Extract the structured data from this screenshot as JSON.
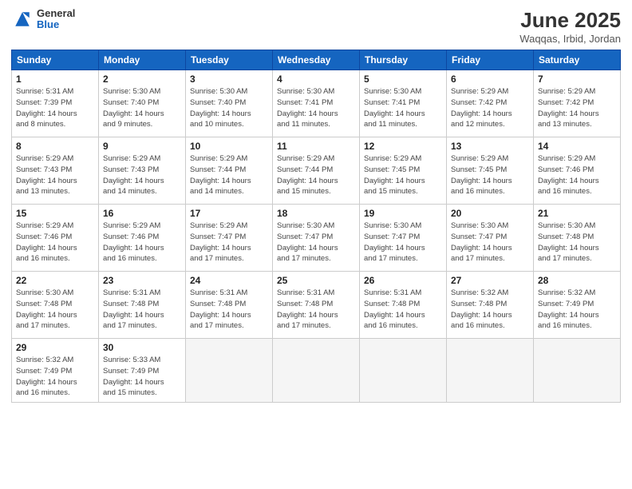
{
  "header": {
    "logo_general": "General",
    "logo_blue": "Blue",
    "month_title": "June 2025",
    "location": "Waqqas, Irbid, Jordan"
  },
  "weekdays": [
    "Sunday",
    "Monday",
    "Tuesday",
    "Wednesday",
    "Thursday",
    "Friday",
    "Saturday"
  ],
  "weeks": [
    [
      {
        "day": "1",
        "info": "Sunrise: 5:31 AM\nSunset: 7:39 PM\nDaylight: 14 hours\nand 8 minutes."
      },
      {
        "day": "2",
        "info": "Sunrise: 5:30 AM\nSunset: 7:40 PM\nDaylight: 14 hours\nand 9 minutes."
      },
      {
        "day": "3",
        "info": "Sunrise: 5:30 AM\nSunset: 7:40 PM\nDaylight: 14 hours\nand 10 minutes."
      },
      {
        "day": "4",
        "info": "Sunrise: 5:30 AM\nSunset: 7:41 PM\nDaylight: 14 hours\nand 11 minutes."
      },
      {
        "day": "5",
        "info": "Sunrise: 5:30 AM\nSunset: 7:41 PM\nDaylight: 14 hours\nand 11 minutes."
      },
      {
        "day": "6",
        "info": "Sunrise: 5:29 AM\nSunset: 7:42 PM\nDaylight: 14 hours\nand 12 minutes."
      },
      {
        "day": "7",
        "info": "Sunrise: 5:29 AM\nSunset: 7:42 PM\nDaylight: 14 hours\nand 13 minutes."
      }
    ],
    [
      {
        "day": "8",
        "info": "Sunrise: 5:29 AM\nSunset: 7:43 PM\nDaylight: 14 hours\nand 13 minutes."
      },
      {
        "day": "9",
        "info": "Sunrise: 5:29 AM\nSunset: 7:43 PM\nDaylight: 14 hours\nand 14 minutes."
      },
      {
        "day": "10",
        "info": "Sunrise: 5:29 AM\nSunset: 7:44 PM\nDaylight: 14 hours\nand 14 minutes."
      },
      {
        "day": "11",
        "info": "Sunrise: 5:29 AM\nSunset: 7:44 PM\nDaylight: 14 hours\nand 15 minutes."
      },
      {
        "day": "12",
        "info": "Sunrise: 5:29 AM\nSunset: 7:45 PM\nDaylight: 14 hours\nand 15 minutes."
      },
      {
        "day": "13",
        "info": "Sunrise: 5:29 AM\nSunset: 7:45 PM\nDaylight: 14 hours\nand 16 minutes."
      },
      {
        "day": "14",
        "info": "Sunrise: 5:29 AM\nSunset: 7:46 PM\nDaylight: 14 hours\nand 16 minutes."
      }
    ],
    [
      {
        "day": "15",
        "info": "Sunrise: 5:29 AM\nSunset: 7:46 PM\nDaylight: 14 hours\nand 16 minutes."
      },
      {
        "day": "16",
        "info": "Sunrise: 5:29 AM\nSunset: 7:46 PM\nDaylight: 14 hours\nand 16 minutes."
      },
      {
        "day": "17",
        "info": "Sunrise: 5:29 AM\nSunset: 7:47 PM\nDaylight: 14 hours\nand 17 minutes."
      },
      {
        "day": "18",
        "info": "Sunrise: 5:30 AM\nSunset: 7:47 PM\nDaylight: 14 hours\nand 17 minutes."
      },
      {
        "day": "19",
        "info": "Sunrise: 5:30 AM\nSunset: 7:47 PM\nDaylight: 14 hours\nand 17 minutes."
      },
      {
        "day": "20",
        "info": "Sunrise: 5:30 AM\nSunset: 7:47 PM\nDaylight: 14 hours\nand 17 minutes."
      },
      {
        "day": "21",
        "info": "Sunrise: 5:30 AM\nSunset: 7:48 PM\nDaylight: 14 hours\nand 17 minutes."
      }
    ],
    [
      {
        "day": "22",
        "info": "Sunrise: 5:30 AM\nSunset: 7:48 PM\nDaylight: 14 hours\nand 17 minutes."
      },
      {
        "day": "23",
        "info": "Sunrise: 5:31 AM\nSunset: 7:48 PM\nDaylight: 14 hours\nand 17 minutes."
      },
      {
        "day": "24",
        "info": "Sunrise: 5:31 AM\nSunset: 7:48 PM\nDaylight: 14 hours\nand 17 minutes."
      },
      {
        "day": "25",
        "info": "Sunrise: 5:31 AM\nSunset: 7:48 PM\nDaylight: 14 hours\nand 17 minutes."
      },
      {
        "day": "26",
        "info": "Sunrise: 5:31 AM\nSunset: 7:48 PM\nDaylight: 14 hours\nand 16 minutes."
      },
      {
        "day": "27",
        "info": "Sunrise: 5:32 AM\nSunset: 7:48 PM\nDaylight: 14 hours\nand 16 minutes."
      },
      {
        "day": "28",
        "info": "Sunrise: 5:32 AM\nSunset: 7:49 PM\nDaylight: 14 hours\nand 16 minutes."
      }
    ],
    [
      {
        "day": "29",
        "info": "Sunrise: 5:32 AM\nSunset: 7:49 PM\nDaylight: 14 hours\nand 16 minutes."
      },
      {
        "day": "30",
        "info": "Sunrise: 5:33 AM\nSunset: 7:49 PM\nDaylight: 14 hours\nand 15 minutes."
      },
      {
        "day": "",
        "info": ""
      },
      {
        "day": "",
        "info": ""
      },
      {
        "day": "",
        "info": ""
      },
      {
        "day": "",
        "info": ""
      },
      {
        "day": "",
        "info": ""
      }
    ]
  ]
}
